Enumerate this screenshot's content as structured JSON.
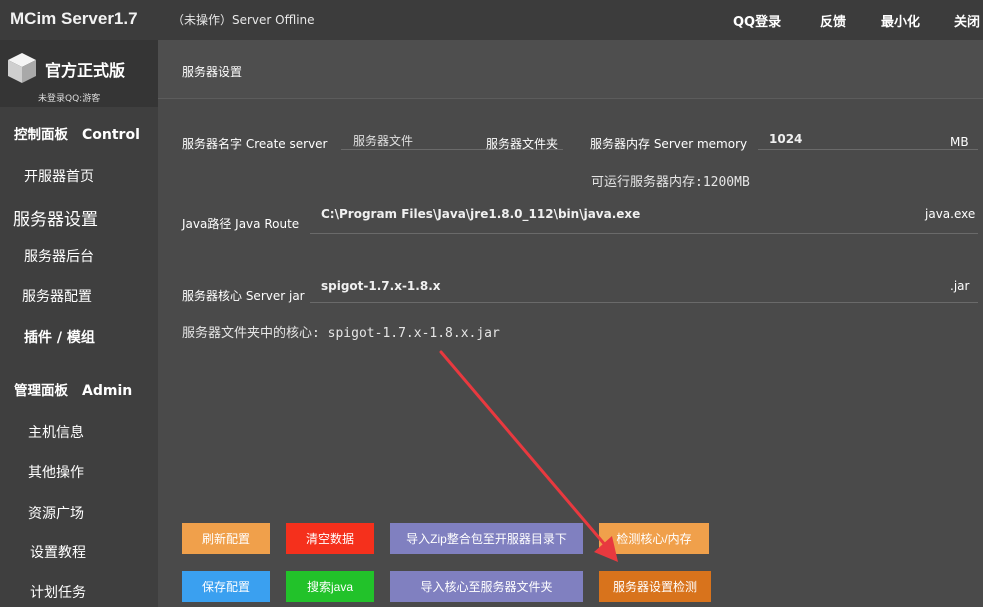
{
  "titlebar": {
    "app_title": "MCim Server1.7",
    "status": "（未操作）Server Offline",
    "actions": [
      "QQ登录",
      "反馈",
      "最小化",
      "关闭"
    ]
  },
  "sidebar": {
    "brand_title": "官方正式版",
    "brand_sub": "未登录QQ:游客",
    "control_section": {
      "cn": "控制面板",
      "en": "Control"
    },
    "control_items": [
      "开服器首页",
      "服务器设置",
      "服务器后台",
      "服务器配置",
      "插件 / 模组"
    ],
    "admin_section": {
      "cn": "管理面板",
      "en": "Admin"
    },
    "admin_items": [
      "主机信息",
      "其他操作",
      "资源广场",
      "设置教程",
      "计划任务"
    ]
  },
  "main": {
    "panel_title": "服务器设置",
    "server_name_label": "服务器名字  Create server",
    "server_name_value": "服务器文件",
    "server_folder_label": "服务器文件夹",
    "memory_label": "服务器内存  Server memory",
    "memory_value": "1024",
    "memory_unit": "MB",
    "available_memory": "可运行服务器内存:1200MB",
    "java_label": "Java路径 Java Route",
    "java_value": "C:\\Program Files\\Java\\jre1.8.0_112\\bin\\java.exe",
    "java_suffix": "java.exe",
    "core_label": "服务器核心 Server jar",
    "core_value": "spigot-1.7.x-1.8.x",
    "core_suffix": ".jar",
    "core_info": "服务器文件夹中的核心:  spigot-1.7.x-1.8.x.jar"
  },
  "buttons": {
    "refresh": "刷新配置",
    "clear": "清空数据",
    "import_zip": "导入Zip整合包至开服器目录下",
    "check_core": "检测核心/内存",
    "save": "保存配置",
    "search_java": "搜索java",
    "import_core": "导入核心至服务器文件夹",
    "check_settings": "服务器设置检测"
  },
  "colors": {
    "orange": "#f0a04b",
    "red": "#f5301c",
    "purple": "#8080c0",
    "blue": "#3aa0f0",
    "green": "#22c22a",
    "dark_orange": "#d8731c",
    "arrow": "#e8393f"
  }
}
